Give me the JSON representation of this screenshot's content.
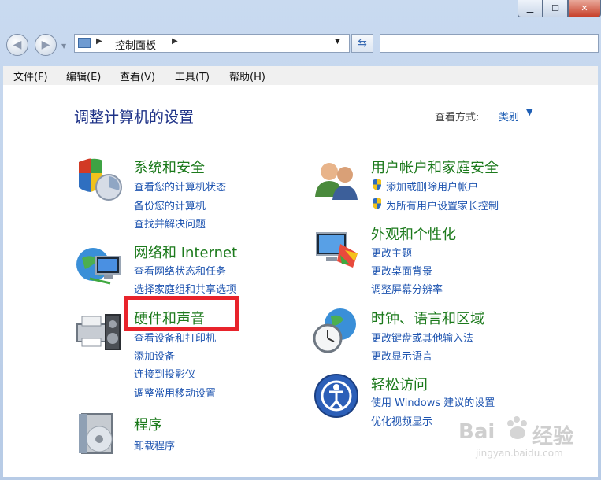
{
  "address": {
    "path": "控制面板"
  },
  "menu": [
    "文件(F)",
    "编辑(E)",
    "查看(V)",
    "工具(T)",
    "帮助(H)"
  ],
  "main": {
    "heading": "调整计算机的设置",
    "view_by_label": "查看方式:",
    "view_by_value": "类别"
  },
  "categories": {
    "system": {
      "title": "系统和安全",
      "links": [
        "查看您的计算机状态",
        "备份您的计算机",
        "查找并解决问题"
      ]
    },
    "network": {
      "title": "网络和 Internet",
      "links": [
        "查看网络状态和任务",
        "选择家庭组和共享选项"
      ]
    },
    "hardware": {
      "title": "硬件和声音",
      "links": [
        "查看设备和打印机",
        "添加设备",
        "连接到投影仪",
        "调整常用移动设置"
      ]
    },
    "programs": {
      "title": "程序",
      "links": [
        "卸载程序"
      ]
    },
    "users": {
      "title": "用户帐户和家庭安全",
      "links": [
        "添加或删除用户帐户",
        "为所有用户设置家长控制"
      ]
    },
    "appearance": {
      "title": "外观和个性化",
      "links": [
        "更改主题",
        "更改桌面背景",
        "调整屏幕分辨率"
      ]
    },
    "clock": {
      "title": "时钟、语言和区域",
      "links": [
        "更改键盘或其他输入法",
        "更改显示语言"
      ]
    },
    "ease": {
      "title": "轻松访问",
      "links": [
        "使用 Windows 建议的设置",
        "优化视频显示"
      ]
    }
  },
  "watermark": {
    "brand_left": "Bai",
    "brand_right": "经验",
    "url": "jingyan.baidu.com"
  },
  "colors": {
    "category_title": "#1c7a1c",
    "link": "#1f55b0",
    "highlight_box": "#e8232b"
  }
}
